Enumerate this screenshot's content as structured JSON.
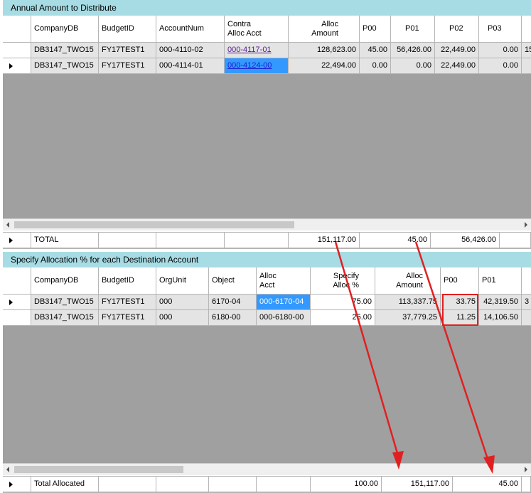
{
  "section1": {
    "title": "Annual Amount to Distribute",
    "headers": [
      "CompanyDB",
      "BudgetID",
      "AccountNum",
      "Contra\nAlloc Acct",
      "Alloc\nAmount",
      "P00",
      "P01",
      "P02",
      "P03",
      ""
    ],
    "rows": [
      [
        "DB3147_TWO15",
        "FY17TEST1",
        "000-4110-02",
        "000-4117-01",
        "128,623.00",
        "45.00",
        "56,426.00",
        "22,449.00",
        "0.00",
        "15"
      ],
      [
        "DB3147_TWO15",
        "FY17TEST1",
        "000-4114-01",
        "000-4124-00",
        "22,494.00",
        "0.00",
        "0.00",
        "22,449.00",
        "0.00",
        ""
      ]
    ],
    "total_label": "TOTAL",
    "totals": [
      "151,117.00",
      "45.00",
      "56,426.00"
    ]
  },
  "section2": {
    "title": "Specify Allocation % for each Destination Account",
    "headers": [
      "CompanyDB",
      "BudgetID",
      "OrgUnit",
      "Object",
      "Alloc\nAcct",
      "Specify\nAlloc %",
      "Alloc\nAmount",
      "P00",
      "P01",
      ""
    ],
    "rows": [
      [
        "DB3147_TWO15",
        "FY17TEST1",
        "000",
        "6170-04",
        "000-6170-04",
        "75.00",
        "113,337.75",
        "33.75",
        "42,319.50",
        "3"
      ],
      [
        "DB3147_TWO15",
        "FY17TEST1",
        "000",
        "6180-00",
        "000-6180-00",
        "25.00",
        "37,779.25",
        "11.25",
        "14,106.50",
        ""
      ]
    ],
    "total_label": "Total Allocated",
    "totals": [
      "100.00",
      "151,117.00",
      "45.00"
    ]
  },
  "colors": {
    "title_bg": "#a8dce4",
    "grid_bg": "#a0a0a0",
    "highlight": "#3399ff",
    "arrow": "#e02020"
  }
}
